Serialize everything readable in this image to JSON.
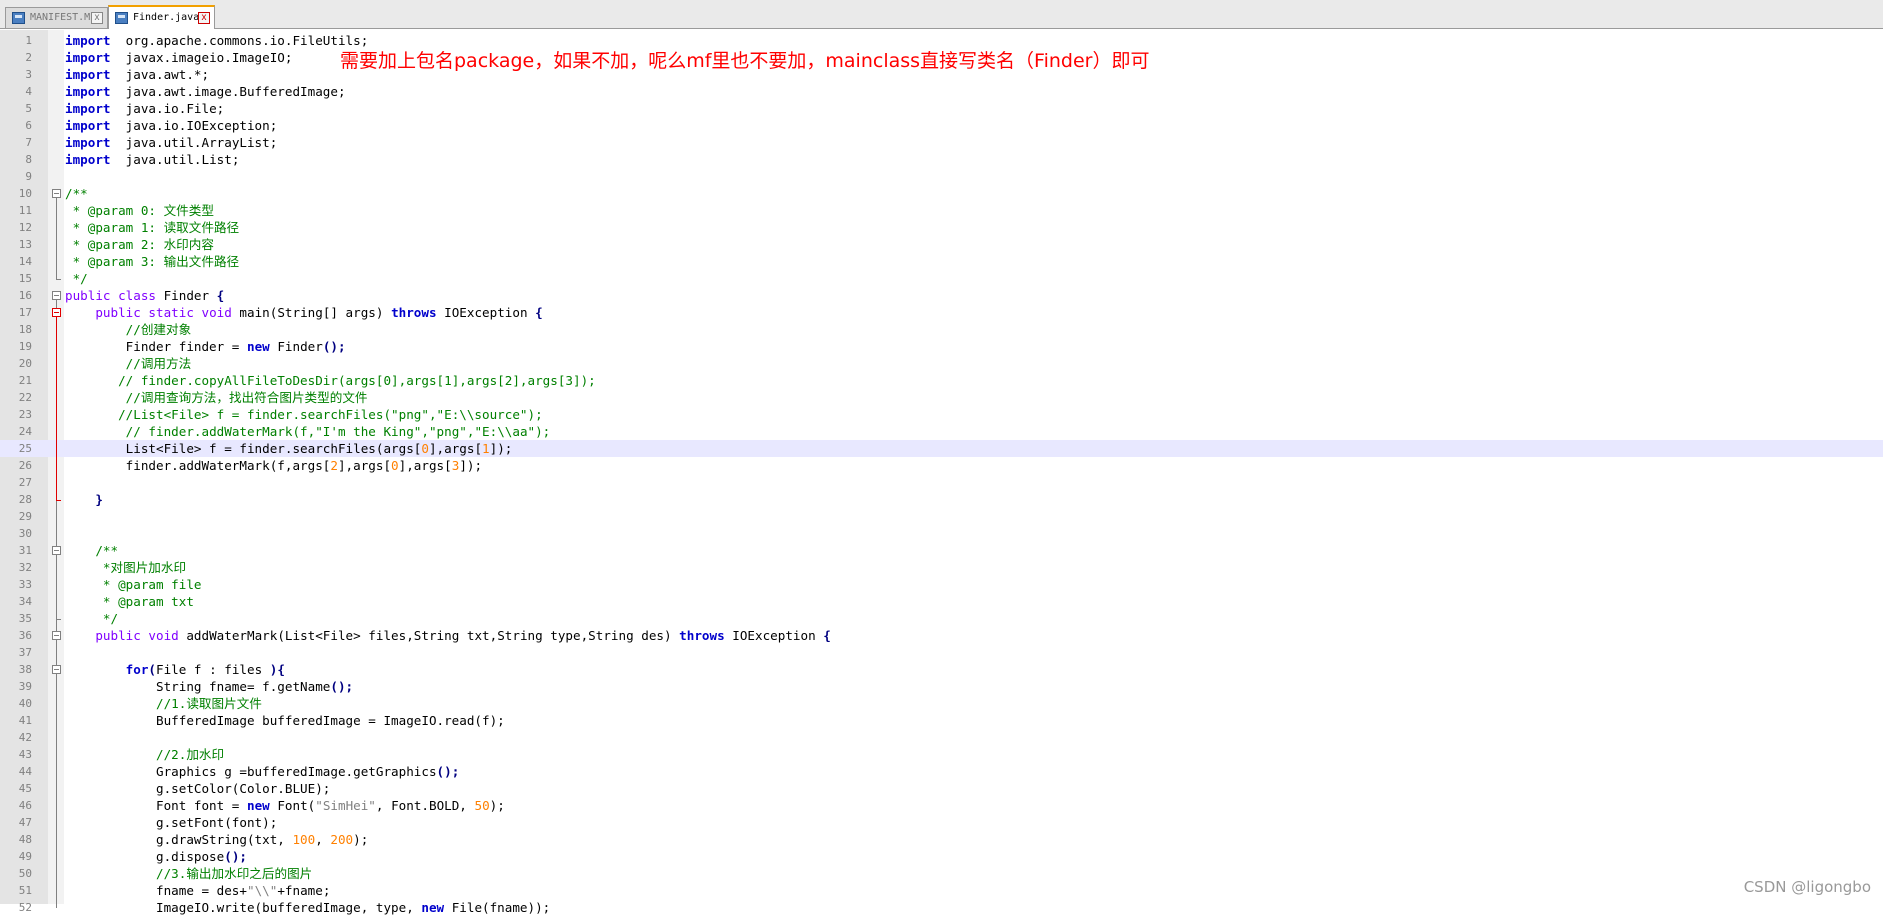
{
  "tabs": [
    {
      "label": "MANIFEST.MF",
      "active": false,
      "icon": "save-file-icon"
    },
    {
      "label": "Finder.java",
      "active": true,
      "icon": "save-file-icon"
    }
  ],
  "annotation_text": "需要加上包名package，如果不加，呢么mf里也不要加，mainclass直接写类名（Finder）即可",
  "watermark": "CSDN @ligongbo",
  "current_line": 25,
  "colors": {
    "keyword": "#0000cc",
    "type_keyword": "#8000ff",
    "comment": "#008000",
    "string": "#808080",
    "number": "#ff8000",
    "annotation": "#ff0000",
    "current_line_bg": "#e8e8ff"
  },
  "lines": [
    [
      [
        "kw",
        "import"
      ],
      [
        "",
        "  org.apache.commons.io.FileUtils;"
      ]
    ],
    [
      [
        "kw",
        "import"
      ],
      [
        "",
        "  javax.imageio.ImageIO;"
      ]
    ],
    [
      [
        "kw",
        "import"
      ],
      [
        "",
        "  java.awt.*;"
      ]
    ],
    [
      [
        "kw",
        "import"
      ],
      [
        "",
        "  java.awt.image.BufferedImage;"
      ]
    ],
    [
      [
        "kw",
        "import"
      ],
      [
        "",
        "  java.io.File;"
      ]
    ],
    [
      [
        "kw",
        "import"
      ],
      [
        "",
        "  java.io.IOException;"
      ]
    ],
    [
      [
        "kw",
        "import"
      ],
      [
        "",
        "  java.util.ArrayList;"
      ]
    ],
    [
      [
        "kw",
        "import"
      ],
      [
        "",
        "  java.util.List;"
      ]
    ],
    [],
    [
      [
        "cmt",
        "/**"
      ]
    ],
    [
      [
        "cmt",
        " * @param 0: 文件类型"
      ]
    ],
    [
      [
        "cmt",
        " * @param 1: 读取文件路径"
      ]
    ],
    [
      [
        "cmt",
        " * @param 2: 水印内容"
      ]
    ],
    [
      [
        "cmt",
        " * @param 3: 输出文件路径"
      ]
    ],
    [
      [
        "cmt",
        " */"
      ]
    ],
    [
      [
        "kw2",
        "public class"
      ],
      [
        "",
        " Finder "
      ],
      [
        "op",
        "{"
      ]
    ],
    [
      [
        "",
        "    "
      ],
      [
        "kw2",
        "public static void"
      ],
      [
        "",
        " main(String[] args) "
      ],
      [
        "kw",
        "throws"
      ],
      [
        "",
        " IOException "
      ],
      [
        "op",
        "{"
      ]
    ],
    [
      [
        "",
        "        "
      ],
      [
        "cmt",
        "//创建对象"
      ]
    ],
    [
      [
        "",
        "        Finder finder = "
      ],
      [
        "kw",
        "new"
      ],
      [
        "",
        " Finder"
      ],
      [
        "op",
        "();"
      ]
    ],
    [
      [
        "",
        "        "
      ],
      [
        "cmt",
        "//调用方法"
      ]
    ],
    [
      [
        "",
        "       "
      ],
      [
        "cmt",
        "// finder.copyAllFileToDesDir(args[0],args[1],args[2],args[3]);"
      ]
    ],
    [
      [
        "",
        "        "
      ],
      [
        "cmt",
        "//调用查询方法，找出符合图片类型的文件"
      ]
    ],
    [
      [
        "",
        "       "
      ],
      [
        "cmt",
        "//List<File> f = finder.searchFiles(\"png\",\"E:\\\\source\");"
      ]
    ],
    [
      [
        "",
        "        "
      ],
      [
        "cmt",
        "// finder.addWaterMark(f,\"I'm the King\",\"png\",\"E:\\\\aa\");"
      ]
    ],
    [
      [
        "",
        "        List<File> f = finder.searchFiles(args["
      ],
      [
        "num",
        "0"
      ],
      [
        "",
        "],args["
      ],
      [
        "num",
        "1"
      ],
      [
        "",
        "]);"
      ]
    ],
    [
      [
        "",
        "        finder.addWaterMark(f,args["
      ],
      [
        "num",
        "2"
      ],
      [
        "",
        "],args["
      ],
      [
        "num",
        "0"
      ],
      [
        "",
        "],args["
      ],
      [
        "num",
        "3"
      ],
      [
        "",
        "]);"
      ]
    ],
    [],
    [
      [
        "",
        "    "
      ],
      [
        "op",
        "}"
      ]
    ],
    [],
    [],
    [
      [
        "",
        "    "
      ],
      [
        "cmt",
        "/**"
      ]
    ],
    [
      [
        "",
        "     "
      ],
      [
        "cmt",
        "*对图片加水印"
      ]
    ],
    [
      [
        "",
        "     "
      ],
      [
        "cmt",
        "* @param file"
      ]
    ],
    [
      [
        "",
        "     "
      ],
      [
        "cmt",
        "* @param txt"
      ]
    ],
    [
      [
        "",
        "     "
      ],
      [
        "cmt",
        "*/"
      ]
    ],
    [
      [
        "",
        "    "
      ],
      [
        "kw2",
        "public void"
      ],
      [
        "",
        " addWaterMark(List<File> files,String txt,String type,String des) "
      ],
      [
        "kw",
        "throws"
      ],
      [
        "",
        " IOException "
      ],
      [
        "op",
        "{"
      ]
    ],
    [],
    [
      [
        "",
        "        "
      ],
      [
        "kw",
        "for"
      ],
      [
        "op",
        "("
      ],
      [
        "",
        "File f : files "
      ],
      [
        "op",
        ")"
      ],
      [
        "op",
        "{"
      ]
    ],
    [
      [
        "",
        "            String fname= f.getName"
      ],
      [
        "op",
        "();"
      ]
    ],
    [
      [
        "",
        "            "
      ],
      [
        "cmt",
        "//1.读取图片文件"
      ]
    ],
    [
      [
        "",
        "            BufferedImage bufferedImage = ImageIO.read(f);"
      ]
    ],
    [],
    [
      [
        "",
        "            "
      ],
      [
        "cmt",
        "//2.加水印"
      ]
    ],
    [
      [
        "",
        "            Graphics g =bufferedImage.getGraphics"
      ],
      [
        "op",
        "();"
      ]
    ],
    [
      [
        "",
        "            g.setColor(Color.BLUE);"
      ]
    ],
    [
      [
        "",
        "            Font font = "
      ],
      [
        "kw",
        "new"
      ],
      [
        "",
        " Font("
      ],
      [
        "str",
        "\"SimHei\""
      ],
      [
        "",
        ", Font.BOLD, "
      ],
      [
        "num",
        "50"
      ],
      [
        "",
        ");"
      ]
    ],
    [
      [
        "",
        "            g.setFont(font);"
      ]
    ],
    [
      [
        "",
        "            g.drawString(txt, "
      ],
      [
        "num",
        "100"
      ],
      [
        "",
        ", "
      ],
      [
        "num",
        "200"
      ],
      [
        "",
        ");"
      ]
    ],
    [
      [
        "",
        "            g.dispose"
      ],
      [
        "op",
        "();"
      ]
    ],
    [
      [
        "",
        "            "
      ],
      [
        "cmt",
        "//3.输出加水印之后的图片"
      ]
    ],
    [
      [
        "",
        "            fname = des+"
      ],
      [
        "str",
        "\"\\\\\""
      ],
      [
        "",
        "+fname;"
      ]
    ],
    [
      [
        "",
        "            ImageIO.write(bufferedImage, type, "
      ],
      [
        "kw",
        "new"
      ],
      [
        "",
        " File(fname));"
      ]
    ]
  ]
}
